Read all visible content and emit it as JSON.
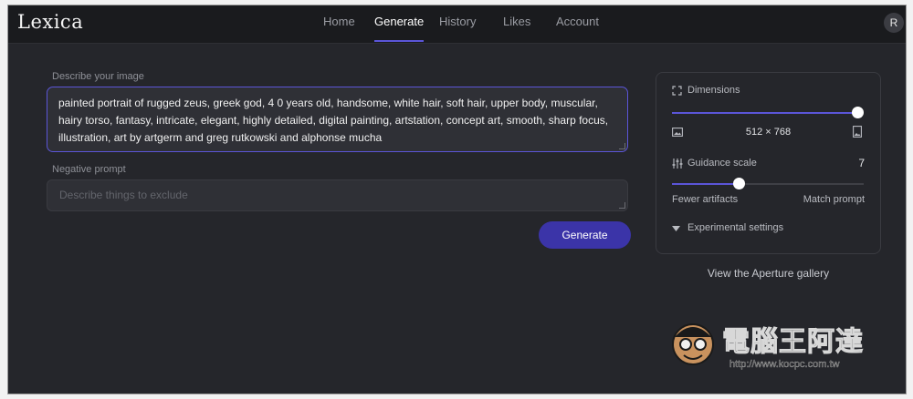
{
  "app": {
    "logo": "Lexica"
  },
  "nav": {
    "tabs": [
      {
        "label": "Home"
      },
      {
        "label": "Generate"
      },
      {
        "label": "History"
      },
      {
        "label": "Likes"
      },
      {
        "label": "Account"
      }
    ],
    "active_tab": "Generate",
    "avatar_initial": "R"
  },
  "form": {
    "prompt_label": "Describe your image",
    "prompt_value": "painted portrait of rugged zeus, greek god, 4 0 years old, handsome, white hair, soft hair, upper body, muscular, hairy torso, fantasy, intricate, elegant, highly detailed, digital painting, artstation, concept art, smooth, sharp focus, illustration, art by artgerm and greg rutkowski and alphonse mucha",
    "negative_label": "Negative prompt",
    "negative_placeholder": "Describe things to exclude",
    "generate_label": "Generate"
  },
  "settings": {
    "dimensions_label": "Dimensions",
    "dimensions_value": "512 × 768",
    "dimensions_slider_fraction": 1.0,
    "guidance_label": "Guidance scale",
    "guidance_value": "7",
    "guidance_slider_fraction": 0.35,
    "guidance_min_label": "Fewer artifacts",
    "guidance_max_label": "Match prompt",
    "experimental_label": "Experimental settings"
  },
  "gallery_link": "View the Aperture gallery",
  "watermark": {
    "title": "電腦王阿達",
    "url": "http://www.kocpc.com.tw"
  },
  "colors": {
    "accent": "#5b55d8",
    "button": "#3b34a8",
    "background": "#25262b"
  }
}
